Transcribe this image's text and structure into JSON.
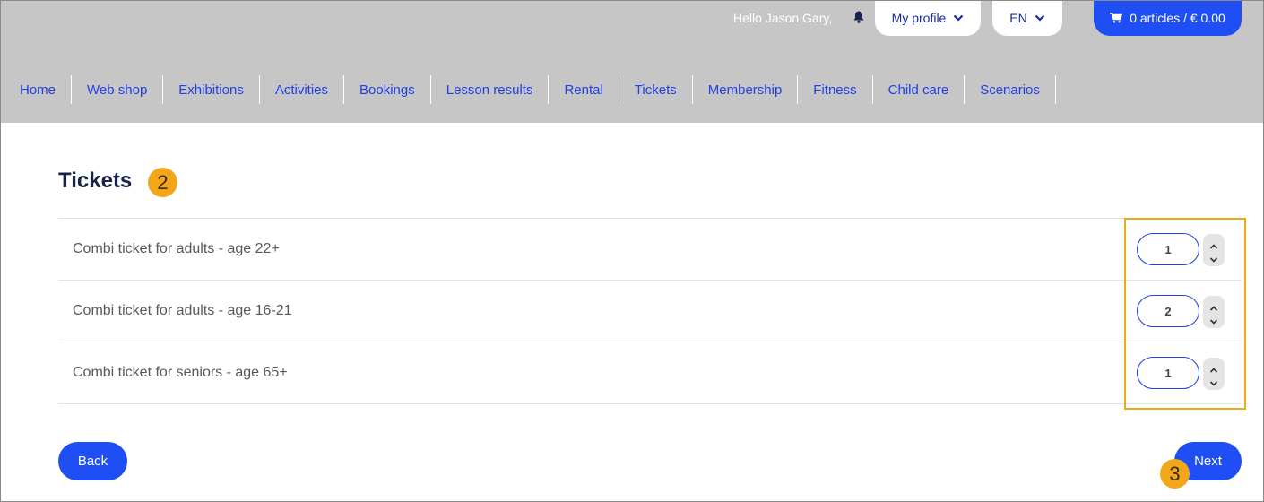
{
  "header": {
    "greeting": "Hello Jason Gary,",
    "profile_label": "My profile",
    "language_label": "EN",
    "cart_label": "0 articles / € 0.00"
  },
  "nav": {
    "items": [
      "Home",
      "Web shop",
      "Exhibitions",
      "Activities",
      "Bookings",
      "Lesson results",
      "Rental",
      "Tickets",
      "Membership",
      "Fitness",
      "Child care",
      "Scenarios"
    ]
  },
  "main": {
    "title": "Tickets",
    "step_badge": "2",
    "tickets": [
      {
        "label": "Combi ticket for adults - age 22+",
        "quantity": "1"
      },
      {
        "label": "Combi ticket for adults - age 16-21",
        "quantity": "2"
      },
      {
        "label": "Combi ticket for seniors - age 65+",
        "quantity": "1"
      }
    ],
    "back_label": "Back",
    "next_label": "Next",
    "next_badge": "3"
  },
  "colors": {
    "header_bg": "#c6c6c6",
    "accent": "#1f4ef5",
    "nav_link": "#2040e8",
    "badge": "#f2a71b"
  },
  "icons": {
    "bell": "bell-icon",
    "chevron": "chevron-down-icon",
    "cart": "cart-icon",
    "stepper_up": "chevron-up-icon",
    "stepper_down": "chevron-down-icon"
  }
}
